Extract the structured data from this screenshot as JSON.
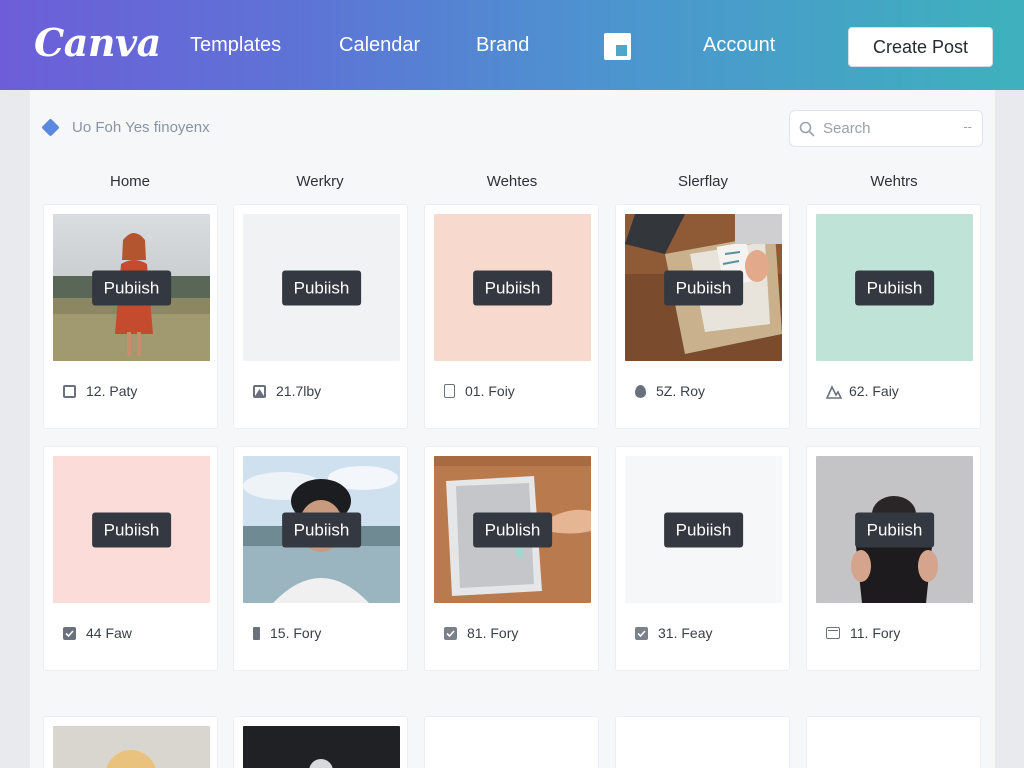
{
  "header": {
    "logo": "Canva",
    "nav": [
      "Templates",
      "Calendar",
      "Brand",
      "Account"
    ],
    "create_button": "Create Post"
  },
  "breadcrumb": "Uo Foh Yes finoyenx",
  "search": {
    "placeholder": "Search",
    "trail": "--"
  },
  "tabs": [
    "Home",
    "Werkry",
    "Wehtes",
    "Slerflay",
    "Wehtrs"
  ],
  "cards": [
    {
      "overlay": "Pubiish",
      "label": "12. Paty",
      "icon": "image-icon",
      "thumb": "photo-woman-field"
    },
    {
      "overlay": "Pubiish",
      "label": "21.7lby",
      "icon": "mountain-icon",
      "thumb": "blank-light"
    },
    {
      "overlay": "Pubiish",
      "label": "01. Foiy",
      "icon": "document-icon",
      "thumb": "peach"
    },
    {
      "overlay": "Pubiish",
      "label": "5Z. Roy",
      "icon": "pin-icon",
      "thumb": "photo-desk"
    },
    {
      "overlay": "Pubiish",
      "label": "62. Faiy",
      "icon": "shape-icon",
      "thumb": "mint"
    },
    {
      "overlay": "Pubiish",
      "label": "44 Faw",
      "icon": "check-icon",
      "thumb": "pink"
    },
    {
      "overlay": "Pubiish",
      "label": "15. Fory",
      "icon": "bookmark-icon",
      "thumb": "photo-man-beach"
    },
    {
      "overlay": "Publish",
      "label": "81. Fory",
      "icon": "check-icon",
      "thumb": "photo-notebook"
    },
    {
      "overlay": "Pubiish",
      "label": "31. Feay",
      "icon": "check-icon",
      "thumb": "blank-white"
    },
    {
      "overlay": "Pubiish",
      "label": "11. Fory",
      "icon": "frame-icon",
      "thumb": "photo-woman-gray"
    }
  ],
  "colors": {
    "gradient_start": "#6d5ed8",
    "gradient_end": "#3eb1bd",
    "publish_bg": "#343841"
  }
}
